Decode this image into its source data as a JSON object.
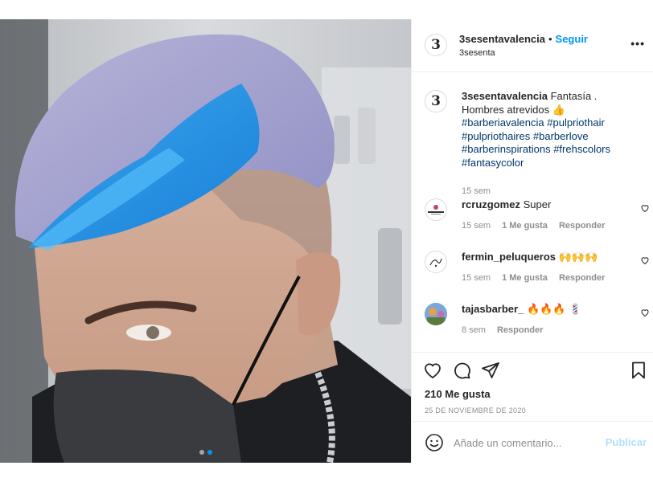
{
  "post": {
    "author": "3sesentavalencia",
    "follow_label": "Seguir",
    "subtitle": "3sesenta",
    "separator": "•",
    "more_label": "•••",
    "avatar_glyph": "3",
    "caption": {
      "username": "3sesentavalencia",
      "text": "Fantasía . Hombres atrevidos 👍",
      "hashtags": [
        "#barberiavalencia",
        "#pulpriothair",
        "#pulpriothaires",
        "#barberlove",
        "#barberinspirations",
        "#frehscolors",
        "#fantasycolor"
      ],
      "time": "15 sem"
    },
    "comments": [
      {
        "username": "rcruzgomez",
        "text": "Super",
        "time": "15 sem",
        "likes": "1 Me gusta",
        "reply": "Responder",
        "avatar_icon": "brand-logo-avatar"
      },
      {
        "username": "fermin_peluqueros",
        "text": "🙌🙌🙌",
        "time": "15 sem",
        "likes": "1 Me gusta",
        "reply": "Responder",
        "avatar_icon": "sketch-logo-avatar"
      },
      {
        "username": "tajasbarber_",
        "text": "🔥🔥🔥 💈",
        "time": "8 sem",
        "likes": "",
        "reply": "Responder",
        "avatar_icon": "photo-avatar"
      }
    ],
    "likes_count": "210 Me gusta",
    "date": "25 DE NOVIEMBRE DE 2020",
    "add_comment_placeholder": "Añade un comentario...",
    "publish_label": "Publicar",
    "carousel": {
      "count": 2,
      "active": 1
    },
    "colors": {
      "accent": "#0095f6",
      "hashtag": "#00376b",
      "muted": "#8e8e8e",
      "publish_disabled": "#b2dffc"
    }
  }
}
